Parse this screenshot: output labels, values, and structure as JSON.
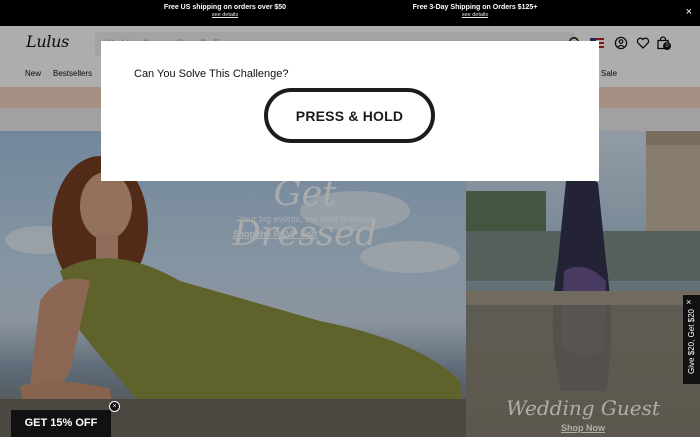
{
  "promo_bar": {
    "left": {
      "text": "Free US shipping on orders over $50",
      "link": "see details"
    },
    "right": {
      "text": "Free 3-Day Shipping on Orders $125+",
      "link": "see details"
    },
    "close_label": "×"
  },
  "header": {
    "logo": "Lulus",
    "search_text": "Wedding Guest... Shop By Event",
    "bag_count": "0"
  },
  "nav": {
    "items": [
      "New",
      "Bestsellers",
      "Sale"
    ]
  },
  "hero": {
    "title": "Get Dressed",
    "subtitle": "Your big events, our best dresses",
    "link": "Shop the RSVP Edit",
    "right_title": "Wedding Guest",
    "right_link": "Shop Now"
  },
  "modal": {
    "title": "Can You Solve This Challenge?",
    "button": "PRESS & HOLD"
  },
  "side_tab": {
    "text": "Give $20, Get $20",
    "close": "×"
  },
  "discount": {
    "label": "GET 15% OFF",
    "close": "×"
  },
  "colors": {
    "black": "#000000",
    "pink_strip": "#f4d4c2",
    "grey_strip": "#ededed"
  }
}
